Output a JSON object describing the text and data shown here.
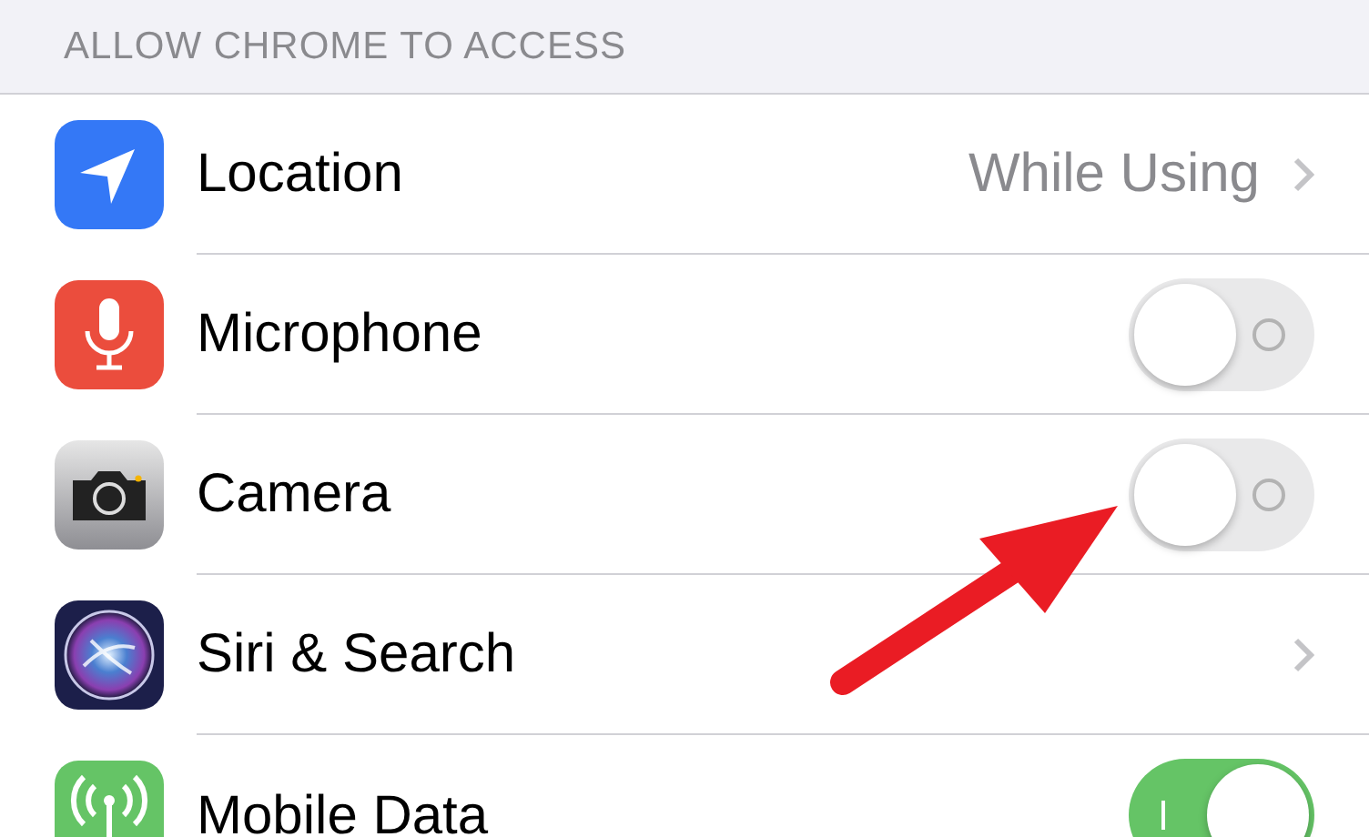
{
  "section_header": "ALLOW CHROME TO ACCESS",
  "rows": [
    {
      "kind": "value",
      "label": "Location",
      "value": "While Using"
    },
    {
      "kind": "toggle",
      "label": "Microphone",
      "on": false
    },
    {
      "kind": "toggle",
      "label": "Camera",
      "on": false
    },
    {
      "kind": "link",
      "label": "Siri & Search"
    },
    {
      "kind": "toggle",
      "label": "Mobile Data",
      "on": true
    }
  ]
}
